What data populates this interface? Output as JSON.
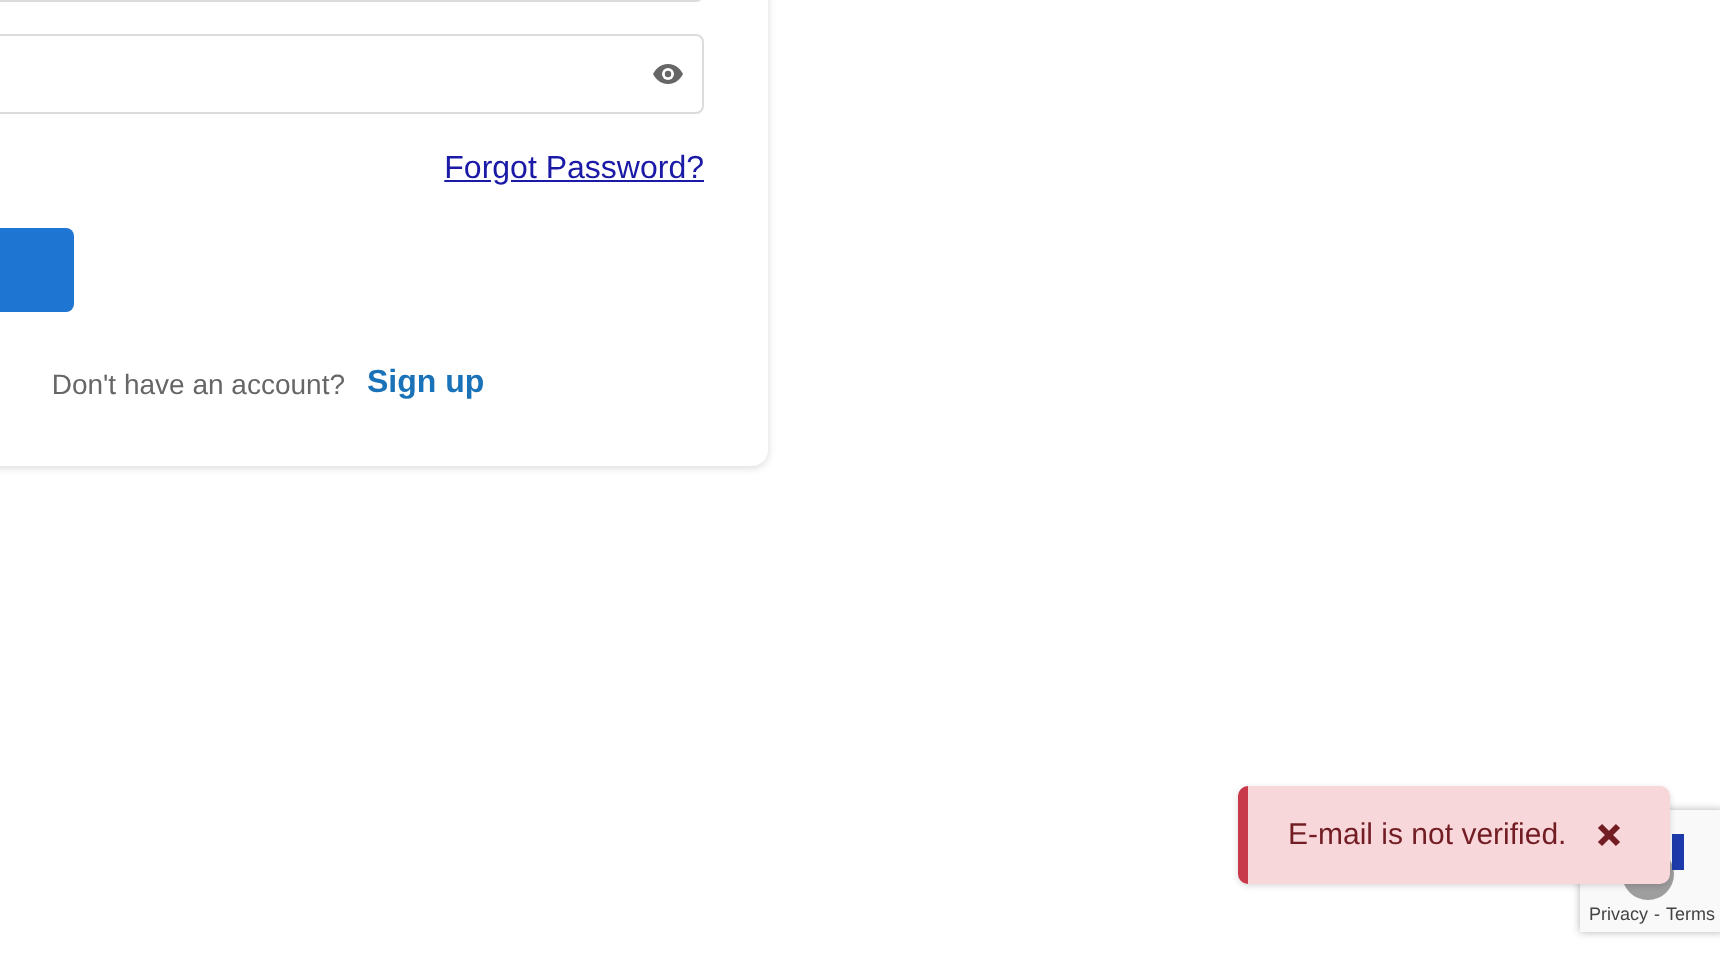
{
  "login_card": {
    "password_field": {
      "kind": "password"
    },
    "forgot_link": "Forgot Password?",
    "signup_prompt": "Don't have an account?",
    "signup_link": "Sign up"
  },
  "toast": {
    "kind": "error",
    "message": "E-mail is not verified."
  },
  "recaptcha_badge": {
    "links": [
      "Privacy",
      "Terms"
    ],
    "separator": "-"
  }
}
